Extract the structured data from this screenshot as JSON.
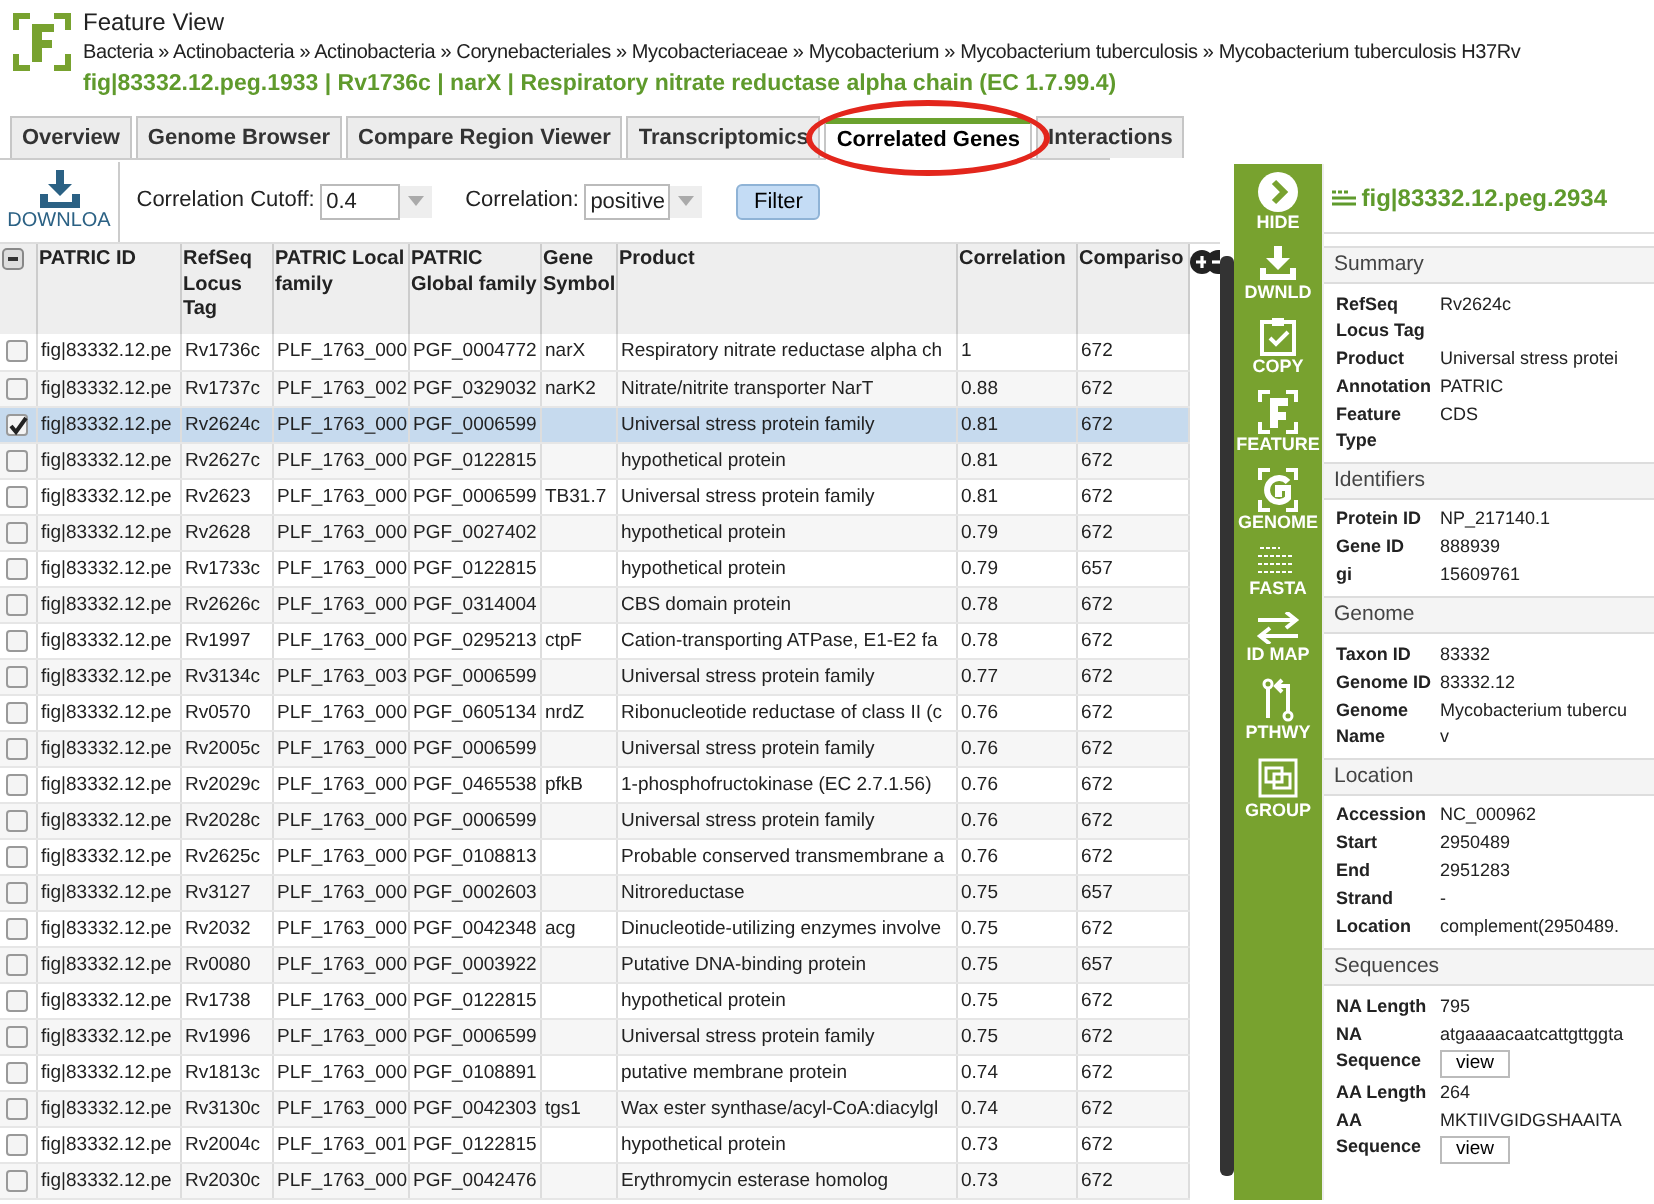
{
  "header": {
    "title": "Feature View",
    "breadcrumb": "Bacteria » Actinobacteria » Actinobacteria » Corynebacteriales » Mycobacteriaceae » Mycobacterium » Mycobacterium tuberculosis » Mycobacterium tuberculosis H37Rv",
    "feature": "fig|83332.12.peg.1933 | Rv1736c | narX | Respiratory nitrate reductase alpha chain (EC 1.7.99.4)"
  },
  "tabs": [
    {
      "label": "Overview",
      "selected": false,
      "circled": false
    },
    {
      "label": "Genome Browser",
      "selected": false,
      "circled": false
    },
    {
      "label": "Compare Region Viewer",
      "selected": false,
      "circled": false
    },
    {
      "label": "Transcriptomics",
      "selected": false,
      "circled": false
    },
    {
      "label": "Correlated Genes",
      "selected": true,
      "circled": true
    },
    {
      "label": "Interactions",
      "selected": false,
      "circled": false
    }
  ],
  "toolbar": {
    "download_label": "DOWNLOA",
    "cutoff_label": "Correlation Cutoff:",
    "cutoff_value": "0.4",
    "correlation_label": "Correlation:",
    "correlation_value": "positive",
    "filter_button": "Filter"
  },
  "table": {
    "columns": [
      "PATRIC ID",
      "RefSeq Locus Tag",
      "PATRIC Local family",
      "PATRIC Global family",
      "Gene Symbol",
      "Product",
      "Correlation",
      "Compariso"
    ],
    "rows": [
      {
        "checked": false,
        "selected": false,
        "cells": [
          "fig|83332.12.pe",
          "Rv1736c",
          "PLF_1763_000",
          "PGF_0004772",
          "narX",
          "Respiratory nitrate reductase alpha ch",
          "1",
          "672"
        ]
      },
      {
        "checked": false,
        "selected": false,
        "cells": [
          "fig|83332.12.pe",
          "Rv1737c",
          "PLF_1763_002",
          "PGF_0329032",
          "narK2",
          "Nitrate/nitrite transporter NarT",
          "0.88",
          "672"
        ]
      },
      {
        "checked": true,
        "selected": true,
        "cells": [
          "fig|83332.12.pe",
          "Rv2624c",
          "PLF_1763_000",
          "PGF_0006599",
          "",
          "Universal stress protein family",
          "0.81",
          "672"
        ]
      },
      {
        "checked": false,
        "selected": false,
        "cells": [
          "fig|83332.12.pe",
          "Rv2627c",
          "PLF_1763_000",
          "PGF_0122815",
          "",
          "hypothetical protein",
          "0.81",
          "672"
        ]
      },
      {
        "checked": false,
        "selected": false,
        "cells": [
          "fig|83332.12.pe",
          "Rv2623",
          "PLF_1763_000",
          "PGF_0006599",
          "TB31.7",
          "Universal stress protein family",
          "0.81",
          "672"
        ]
      },
      {
        "checked": false,
        "selected": false,
        "cells": [
          "fig|83332.12.pe",
          "Rv2628",
          "PLF_1763_000",
          "PGF_0027402",
          "",
          "hypothetical protein",
          "0.79",
          "672"
        ]
      },
      {
        "checked": false,
        "selected": false,
        "cells": [
          "fig|83332.12.pe",
          "Rv1733c",
          "PLF_1763_000",
          "PGF_0122815",
          "",
          "hypothetical protein",
          "0.79",
          "657"
        ]
      },
      {
        "checked": false,
        "selected": false,
        "cells": [
          "fig|83332.12.pe",
          "Rv2626c",
          "PLF_1763_000",
          "PGF_0314004",
          "",
          "CBS domain protein",
          "0.78",
          "672"
        ]
      },
      {
        "checked": false,
        "selected": false,
        "cells": [
          "fig|83332.12.pe",
          "Rv1997",
          "PLF_1763_000",
          "PGF_0295213",
          "ctpF",
          "Cation-transporting ATPase, E1-E2 fa",
          "0.78",
          "672"
        ]
      },
      {
        "checked": false,
        "selected": false,
        "cells": [
          "fig|83332.12.pe",
          "Rv3134c",
          "PLF_1763_003",
          "PGF_0006599",
          "",
          "Universal stress protein family",
          "0.77",
          "672"
        ]
      },
      {
        "checked": false,
        "selected": false,
        "cells": [
          "fig|83332.12.pe",
          "Rv0570",
          "PLF_1763_000",
          "PGF_0605134",
          "nrdZ",
          "Ribonucleotide reductase of class II (c",
          "0.76",
          "672"
        ]
      },
      {
        "checked": false,
        "selected": false,
        "cells": [
          "fig|83332.12.pe",
          "Rv2005c",
          "PLF_1763_000",
          "PGF_0006599",
          "",
          "Universal stress protein family",
          "0.76",
          "672"
        ]
      },
      {
        "checked": false,
        "selected": false,
        "cells": [
          "fig|83332.12.pe",
          "Rv2029c",
          "PLF_1763_000",
          "PGF_0465538",
          "pfkB",
          "1-phosphofructokinase (EC 2.7.1.56)",
          "0.76",
          "672"
        ]
      },
      {
        "checked": false,
        "selected": false,
        "cells": [
          "fig|83332.12.pe",
          "Rv2028c",
          "PLF_1763_000",
          "PGF_0006599",
          "",
          "Universal stress protein family",
          "0.76",
          "672"
        ]
      },
      {
        "checked": false,
        "selected": false,
        "cells": [
          "fig|83332.12.pe",
          "Rv2625c",
          "PLF_1763_000",
          "PGF_0108813",
          "",
          "Probable conserved transmembrane a",
          "0.76",
          "672"
        ]
      },
      {
        "checked": false,
        "selected": false,
        "cells": [
          "fig|83332.12.pe",
          "Rv3127",
          "PLF_1763_000",
          "PGF_0002603",
          "",
          "Nitroreductase",
          "0.75",
          "657"
        ]
      },
      {
        "checked": false,
        "selected": false,
        "cells": [
          "fig|83332.12.pe",
          "Rv2032",
          "PLF_1763_000",
          "PGF_0042348",
          "acg",
          "Dinucleotide-utilizing enzymes involve",
          "0.75",
          "672"
        ]
      },
      {
        "checked": false,
        "selected": false,
        "cells": [
          "fig|83332.12.pe",
          "Rv0080",
          "PLF_1763_000",
          "PGF_0003922",
          "",
          "Putative DNA-binding protein",
          "0.75",
          "657"
        ]
      },
      {
        "checked": false,
        "selected": false,
        "cells": [
          "fig|83332.12.pe",
          "Rv1738",
          "PLF_1763_000",
          "PGF_0122815",
          "",
          "hypothetical protein",
          "0.75",
          "672"
        ]
      },
      {
        "checked": false,
        "selected": false,
        "cells": [
          "fig|83332.12.pe",
          "Rv1996",
          "PLF_1763_000",
          "PGF_0006599",
          "",
          "Universal stress protein family",
          "0.75",
          "672"
        ]
      },
      {
        "checked": false,
        "selected": false,
        "cells": [
          "fig|83332.12.pe",
          "Rv1813c",
          "PLF_1763_000",
          "PGF_0108891",
          "",
          "putative membrane protein",
          "0.74",
          "672"
        ]
      },
      {
        "checked": false,
        "selected": false,
        "cells": [
          "fig|83332.12.pe",
          "Rv3130c",
          "PLF_1763_000",
          "PGF_0042303",
          "tgs1",
          "Wax ester synthase/acyl-CoA:diacylgl",
          "0.74",
          "672"
        ]
      },
      {
        "checked": false,
        "selected": false,
        "cells": [
          "fig|83332.12.pe",
          "Rv2004c",
          "PLF_1763_001",
          "PGF_0122815",
          "",
          "hypothetical protein",
          "0.73",
          "672"
        ]
      },
      {
        "checked": false,
        "selected": false,
        "cells": [
          "fig|83332.12.pe",
          "Rv2030c",
          "PLF_1763_000",
          "PGF_0042476",
          "",
          "Erythromycin esterase homolog",
          "0.73",
          "672"
        ]
      }
    ]
  },
  "actions": [
    {
      "kind": "hide",
      "label": "HIDE"
    },
    {
      "kind": "download",
      "label": "DWNLD"
    },
    {
      "kind": "copy",
      "label": "COPY"
    },
    {
      "kind": "feature",
      "label": "FEATURE"
    },
    {
      "kind": "genome",
      "label": "GENOME"
    },
    {
      "kind": "fasta",
      "label": "FASTA"
    },
    {
      "kind": "idmap",
      "label": "ID MAP"
    },
    {
      "kind": "pathway",
      "label": "PTHWY"
    },
    {
      "kind": "group",
      "label": "GROUP"
    }
  ],
  "details": {
    "title": "fig|83332.12.peg.2934",
    "sections": [
      {
        "title": "Summary",
        "fields": [
          {
            "label": "RefSeq Locus Tag",
            "value": "Rv2624c"
          },
          {
            "label": "Product",
            "value": "Universal stress protei"
          },
          {
            "label": "Annotation",
            "value": "PATRIC"
          },
          {
            "label": "Feature Type",
            "value": "CDS"
          }
        ]
      },
      {
        "title": "Identifiers",
        "fields": [
          {
            "label": "Protein ID",
            "value": "NP_217140.1"
          },
          {
            "label": "Gene ID",
            "value": "888939"
          },
          {
            "label": "gi",
            "value": "15609761"
          }
        ]
      },
      {
        "title": "Genome",
        "fields": [
          {
            "label": "Taxon ID",
            "value": "83332"
          },
          {
            "label": "Genome ID",
            "value": "83332.12"
          },
          {
            "label": "Genome Name",
            "value": "Mycobacterium tubercu\nv"
          }
        ]
      },
      {
        "title": "Location",
        "fields": [
          {
            "label": "Accession",
            "value": "NC_000962"
          },
          {
            "label": "Start",
            "value": "2950489"
          },
          {
            "label": "End",
            "value": "2951283"
          },
          {
            "label": "Strand",
            "value": "-"
          },
          {
            "label": "Location",
            "value": "complement(2950489."
          }
        ]
      },
      {
        "title": "Sequences",
        "fields": [
          {
            "label": "NA Length",
            "value": "795"
          },
          {
            "label": "NA Sequence",
            "value": "atgaaaacaatcattgttggta",
            "button": "view"
          },
          {
            "label": "AA Length",
            "value": "264"
          },
          {
            "label": "AA Sequence",
            "value": "MKTIIVGIDGSHAAITA",
            "button": "view"
          }
        ]
      }
    ]
  }
}
